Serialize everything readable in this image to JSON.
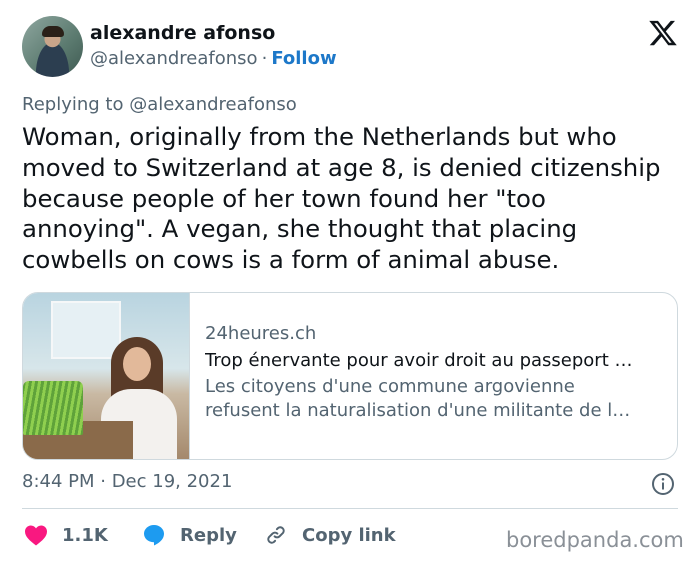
{
  "author": {
    "display_name": "alexandre afonso",
    "handle": "@alexandreafonso",
    "separator": "·",
    "follow_label": "Follow"
  },
  "platform_icon": "x-logo-icon",
  "replying": {
    "prefix": "Replying to",
    "mention": "@alexandreafonso"
  },
  "tweet": {
    "text": "Woman, originally from the Netherlands but who moved to Switzerland at age 8, is denied citizenship because people of her town found her \"too annoying\". A vegan, she thought that placing cowbells on cows is a form of animal abuse."
  },
  "link_card": {
    "domain": "24heures.ch",
    "title": "Trop énervante pour avoir droit au passeport …",
    "description_line1": "Les citoyens d'une commune argovienne",
    "description_line2": "refusent la naturalisation d'une militante de l…"
  },
  "meta": {
    "timestamp": "8:44 PM · Dec 19, 2021",
    "info_icon": "info-icon"
  },
  "actions": {
    "like_count": "1.1K",
    "reply_label": "Reply",
    "copy_label": "Copy link"
  },
  "watermark": "boredpanda.com",
  "colors": {
    "accent": "#1d78c9",
    "like": "#f91880",
    "reply_icon": "#1d9bf0",
    "muted": "#536471",
    "border": "#cfd9de"
  }
}
